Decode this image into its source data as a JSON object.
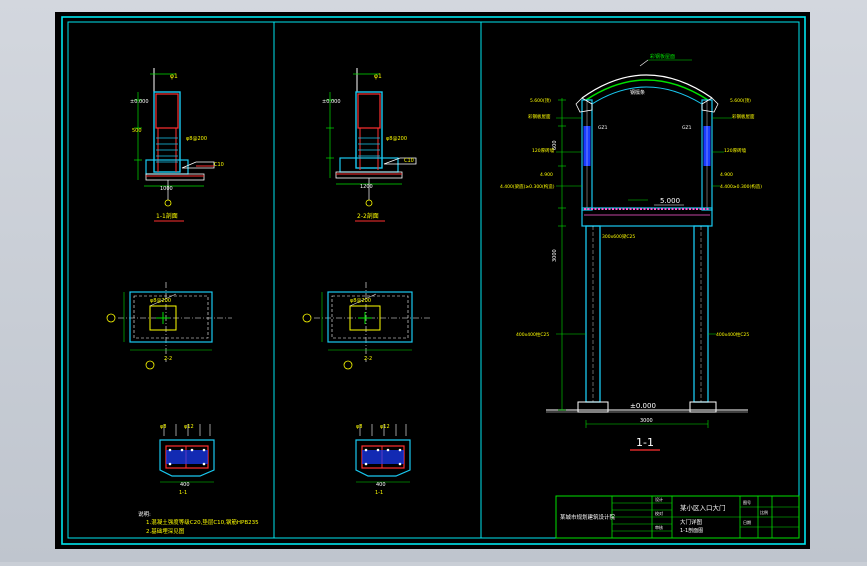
{
  "colors": {
    "viewport_bg": "#c9ced6",
    "sheet_bg": "#000000",
    "frame": "#00e5ee",
    "wall": "#19c8f0",
    "rebar": "#ff3030",
    "dim_green": "#00e000",
    "text_yellow": "#ffff00",
    "text_white": "#ffffff",
    "beam_magenta": "#ff5cd6",
    "column_blue": "#1a3cff"
  },
  "details": {
    "section_1": {
      "title": "1-1剖面"
    },
    "section_2": {
      "title": "2-2剖面"
    },
    "plan_1": {
      "label": "2-2"
    },
    "plan_2": {
      "label": "2-2"
    },
    "beam_1": {
      "label": "1-1"
    },
    "beam_2": {
      "label": "1-1"
    }
  },
  "notes": {
    "heading": "说明:",
    "line_1": "1.混凝土强度等级C20,垫层C10,钢筋HPB235",
    "line_2": "2.基础埋深见图"
  },
  "main_section": {
    "title": "1-1",
    "level_top": "5.000",
    "level_ground": "±0.000"
  },
  "title_block": {
    "company": "某城市规划建筑设计院",
    "project": "某小区入口大门",
    "drawing_name": "大门详图",
    "drawing_sub": "1-1剖面图"
  }
}
